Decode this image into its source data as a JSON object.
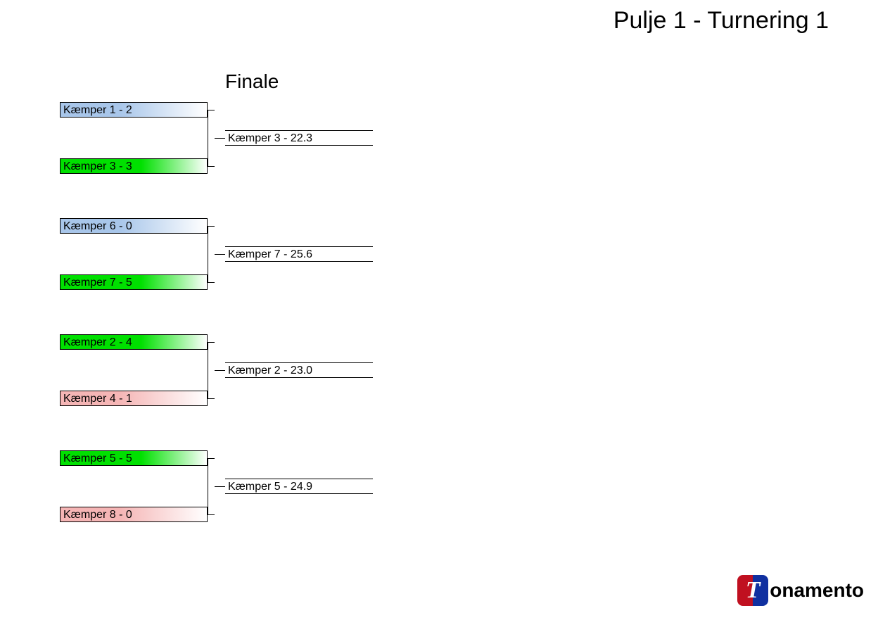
{
  "title": "Pulje 1 - Turnering 1",
  "round_label": "Finale",
  "matches": [
    {
      "top": {
        "label": "Kæmper 1 - 2",
        "color": "blue"
      },
      "bottom": {
        "label": "Kæmper 3 - 3",
        "color": "green"
      },
      "result": "Kæmper 3 - 22.3"
    },
    {
      "top": {
        "label": "Kæmper 6 - 0",
        "color": "blue"
      },
      "bottom": {
        "label": "Kæmper 7 - 5",
        "color": "green"
      },
      "result": "Kæmper 7 - 25.6"
    },
    {
      "top": {
        "label": "Kæmper 2 - 4",
        "color": "green"
      },
      "bottom": {
        "label": "Kæmper 4 - 1",
        "color": "red"
      },
      "result": "Kæmper 2 - 23.0"
    },
    {
      "top": {
        "label": "Kæmper 5 - 5",
        "color": "green"
      },
      "bottom": {
        "label": "Kæmper 8 - 0",
        "color": "red"
      },
      "result": "Kæmper 5 - 24.9"
    }
  ],
  "logo": {
    "letter": "T",
    "rest": "onamento"
  }
}
